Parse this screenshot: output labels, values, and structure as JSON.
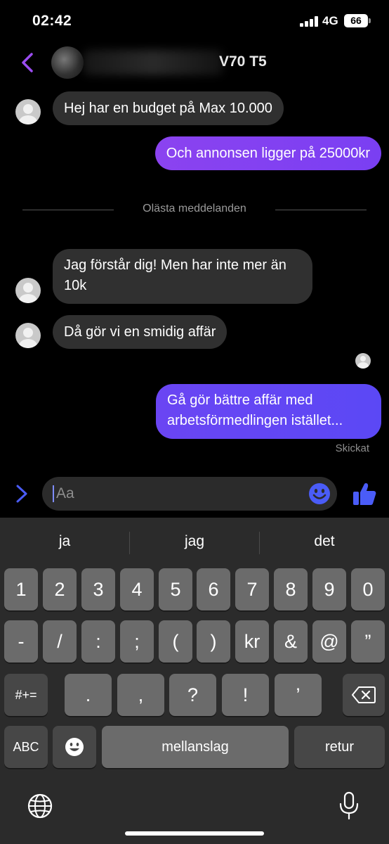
{
  "status_bar": {
    "time": "02:42",
    "network": "4G",
    "battery": "66"
  },
  "header": {
    "title": "V70 T5"
  },
  "messages": {
    "m1": "Hej har en budget på Max 10.000",
    "m2": "Och annonsen ligger på 25000kr",
    "divider": "Olästa meddelanden",
    "m3": "Jag förstår dig! Men har inte mer än 10k",
    "m4": "Då gör vi en smidig affär",
    "m5": "Gå gör bättre affär med arbetsförmedlingen istället...",
    "status": "Skickat"
  },
  "composer": {
    "placeholder": "Aa"
  },
  "keyboard": {
    "suggestions": [
      "ja",
      "jag",
      "det"
    ],
    "row1": [
      "1",
      "2",
      "3",
      "4",
      "5",
      "6",
      "7",
      "8",
      "9",
      "0"
    ],
    "row2": [
      "-",
      "/",
      ":",
      ";",
      "(",
      ")",
      "kr",
      "&",
      "@",
      "”"
    ],
    "row3": [
      ".",
      ",",
      "?",
      "!",
      "’"
    ],
    "symbols_key": "#+=",
    "abc_key": "ABC",
    "space_key": "mellanslag",
    "return_key": "retur"
  },
  "colors": {
    "accent_purple": "#9a4cf0",
    "bubble_out_start": "#7d3df2",
    "bubble_out_end": "#5848f5",
    "icon_blue": "#4a5cf7"
  },
  "icons": [
    "back-icon",
    "expand-icon",
    "emoji-icon",
    "like-icon",
    "backspace-icon",
    "emoji-keyboard-icon",
    "globe-icon",
    "microphone-icon"
  ]
}
